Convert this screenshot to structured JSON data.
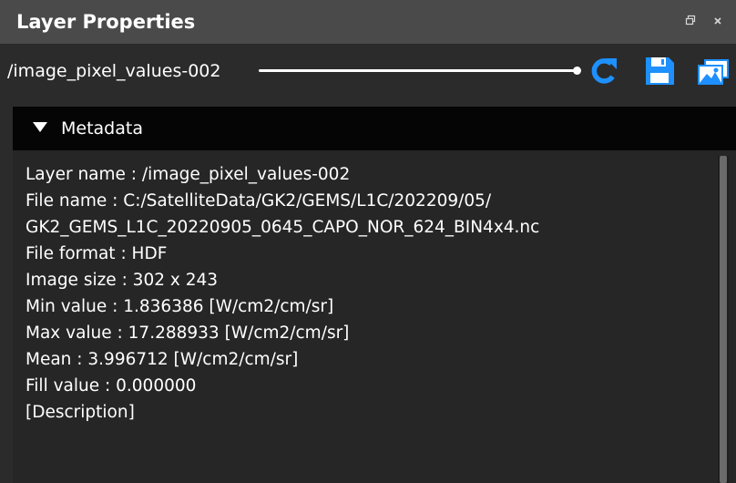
{
  "panel": {
    "title": "Layer Properties",
    "restore_icon": "restore-window-icon",
    "close_icon": "close-icon"
  },
  "toolbar": {
    "path": "/image_pixel_values-002",
    "refresh_icon": "refresh-icon",
    "save_icon": "save-icon",
    "image_icon": "image-icon",
    "accent_color": "#1e90ff"
  },
  "metadata": {
    "header_label": "Metadata",
    "lines": [
      "Layer name : /image_pixel_values-002",
      "File name : C:/SatelliteData/GK2/GEMS/L1C/202209/05/",
      "GK2_GEMS_L1C_20220905_0645_CAPO_NOR_624_BIN4x4.nc",
      "File format : HDF",
      "Image size : 302 x 243",
      "Min value : 1.836386 [W/cm2/cm/sr]",
      "Max value : 17.288933 [W/cm2/cm/sr]",
      "Mean : 3.996712 [W/cm2/cm/sr]",
      "Fill value : 0.000000",
      "[Description]"
    ]
  }
}
